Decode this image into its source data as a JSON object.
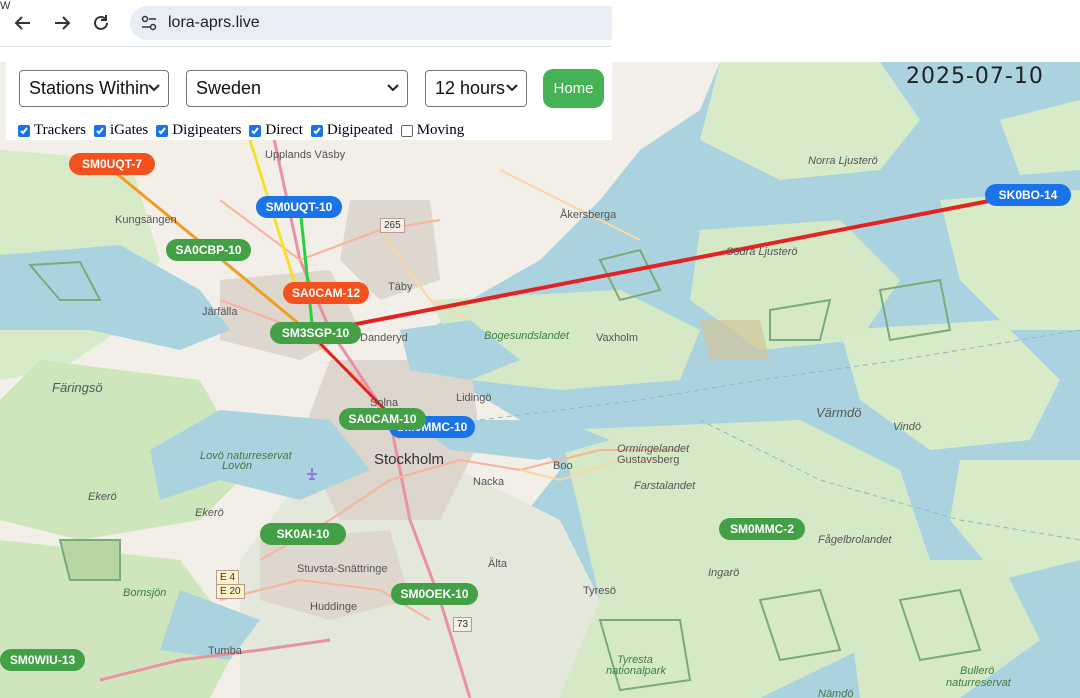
{
  "browser": {
    "url": "lora-aprs.live"
  },
  "page": {
    "date": "2025-07-10",
    "edge_text": "W"
  },
  "controls": {
    "scope": "Stations Within",
    "region": "Sweden",
    "period": "12 hours",
    "home_label": "Home",
    "filters": [
      {
        "label": "Trackers",
        "checked": true
      },
      {
        "label": "iGates",
        "checked": true
      },
      {
        "label": "Digipeaters",
        "checked": true
      },
      {
        "label": "Direct",
        "checked": true
      },
      {
        "label": "Digipeated",
        "checked": true
      },
      {
        "label": "Moving",
        "checked": false
      }
    ]
  },
  "stations": [
    {
      "call": "SM0UQT-7",
      "color": "#f4511e"
    },
    {
      "call": "SM0UQT-10",
      "color": "#1a73e8"
    },
    {
      "call": "SA0CBP-10",
      "color": "#43a047"
    },
    {
      "call": "SA0CAM-12",
      "color": "#f4511e"
    },
    {
      "call": "SM3SGP-10",
      "color": "#43a047"
    },
    {
      "call": "SK0BO-14",
      "color": "#1a73e8"
    },
    {
      "call": "SM0MMC-10",
      "color": "#1a73e8"
    },
    {
      "call": "SA0CAM-10",
      "color": "#43a047"
    },
    {
      "call": "SK0AI-10",
      "color": "#43a047"
    },
    {
      "call": "SM0MMC-2",
      "color": "#43a047"
    },
    {
      "call": "SM0OEK-10",
      "color": "#43a047"
    },
    {
      "call": "SM0WIU-13",
      "color": "#43a047"
    }
  ],
  "map_labels": {
    "upplands_vasby": "Upplands Väsby",
    "kungsangen": "Kungsängen",
    "jarfalla": "Järfälla",
    "taby": "Täby",
    "akersberga": "Åkersberga",
    "norra_ljustero": "Norra Ljusterö",
    "sodra_ljustero": "Södra Ljusterö",
    "danderyd": "Danderyd",
    "vaxholm": "Vaxholm",
    "bogesundslandet": "Bogesundslandet",
    "faringso": "Färingsö",
    "lidingo": "Lidingö",
    "solna": "Solna",
    "stockholm": "Stockholm",
    "lovo1": "Lovö naturreservat",
    "lovo2": "Lovön",
    "boo": "Boo",
    "nacka": "Nacka",
    "varmdo": "Värmdö",
    "vindo": "Vindö",
    "ormingelandet": "Ormingelandet",
    "gustavsberg": "Gustavsberg",
    "farstalandet": "Farstalandet",
    "fagelbrolandet": "Fågelbrolandet",
    "ingaro": "Ingarö",
    "ekero1": "Ekerö",
    "ekero2": "Ekerö",
    "stuvsta": "Stuvsta-Snättringe",
    "alta": "Älta",
    "huddinge": "Huddinge",
    "tyreso": "Tyresö",
    "bornsjon": "Bornsjön",
    "tumba": "Tumba",
    "tyresta1": "Tyresta",
    "tyresta2": "nationalpark",
    "bullero1": "Bullerö",
    "bullero2": "naturreservat",
    "namdo": "Nämdö",
    "road_265": "265",
    "road_e4": "E 4",
    "road_e20": "E 20",
    "road_73": "73"
  }
}
